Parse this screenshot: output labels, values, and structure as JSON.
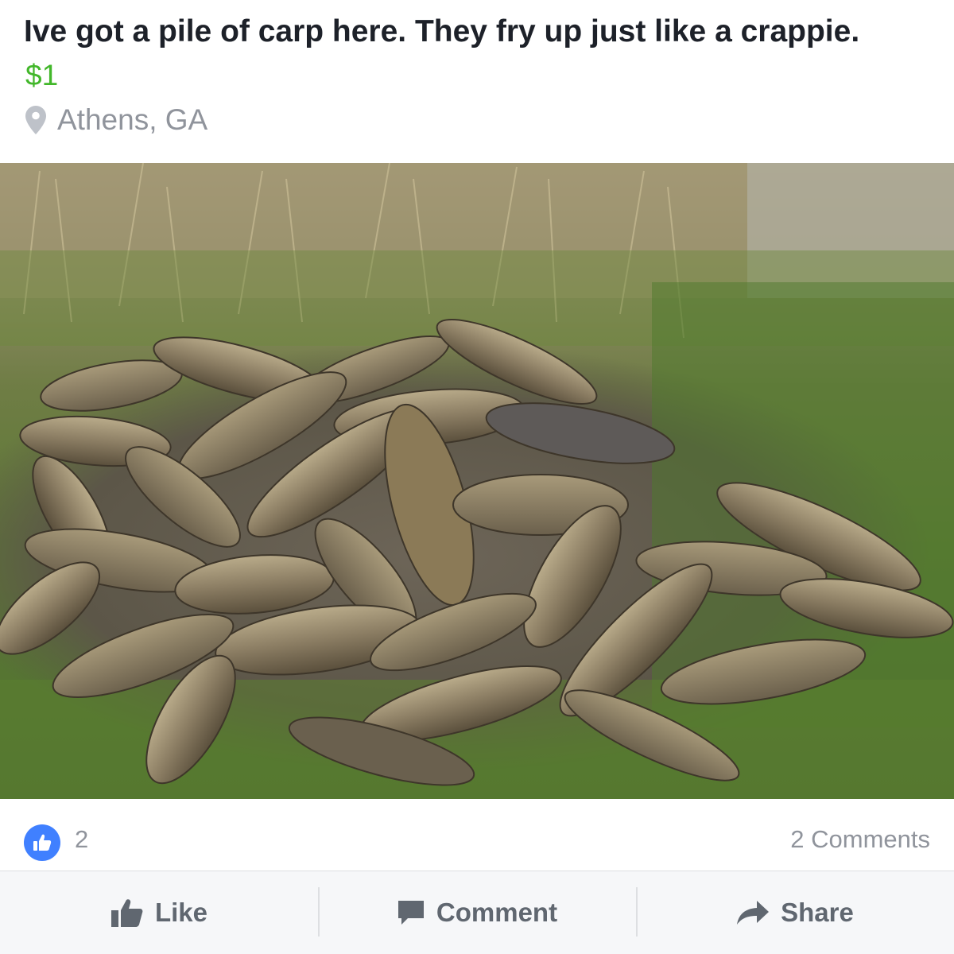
{
  "post": {
    "title": "Ive got a pile of carp here. They fry up just like a crappie.",
    "price": "$1",
    "location": "Athens, GA"
  },
  "photo": {
    "description_icon": "fish-pile-photo"
  },
  "stats": {
    "likes": "2",
    "comments": "2 Comments"
  },
  "actions": {
    "like_label": "Like",
    "comment_label": "Comment",
    "share_label": "Share"
  },
  "colors": {
    "price": "#42b72a",
    "accent": "#4080ff",
    "muted": "#90949c",
    "action_bar": "#f6f7f9"
  }
}
